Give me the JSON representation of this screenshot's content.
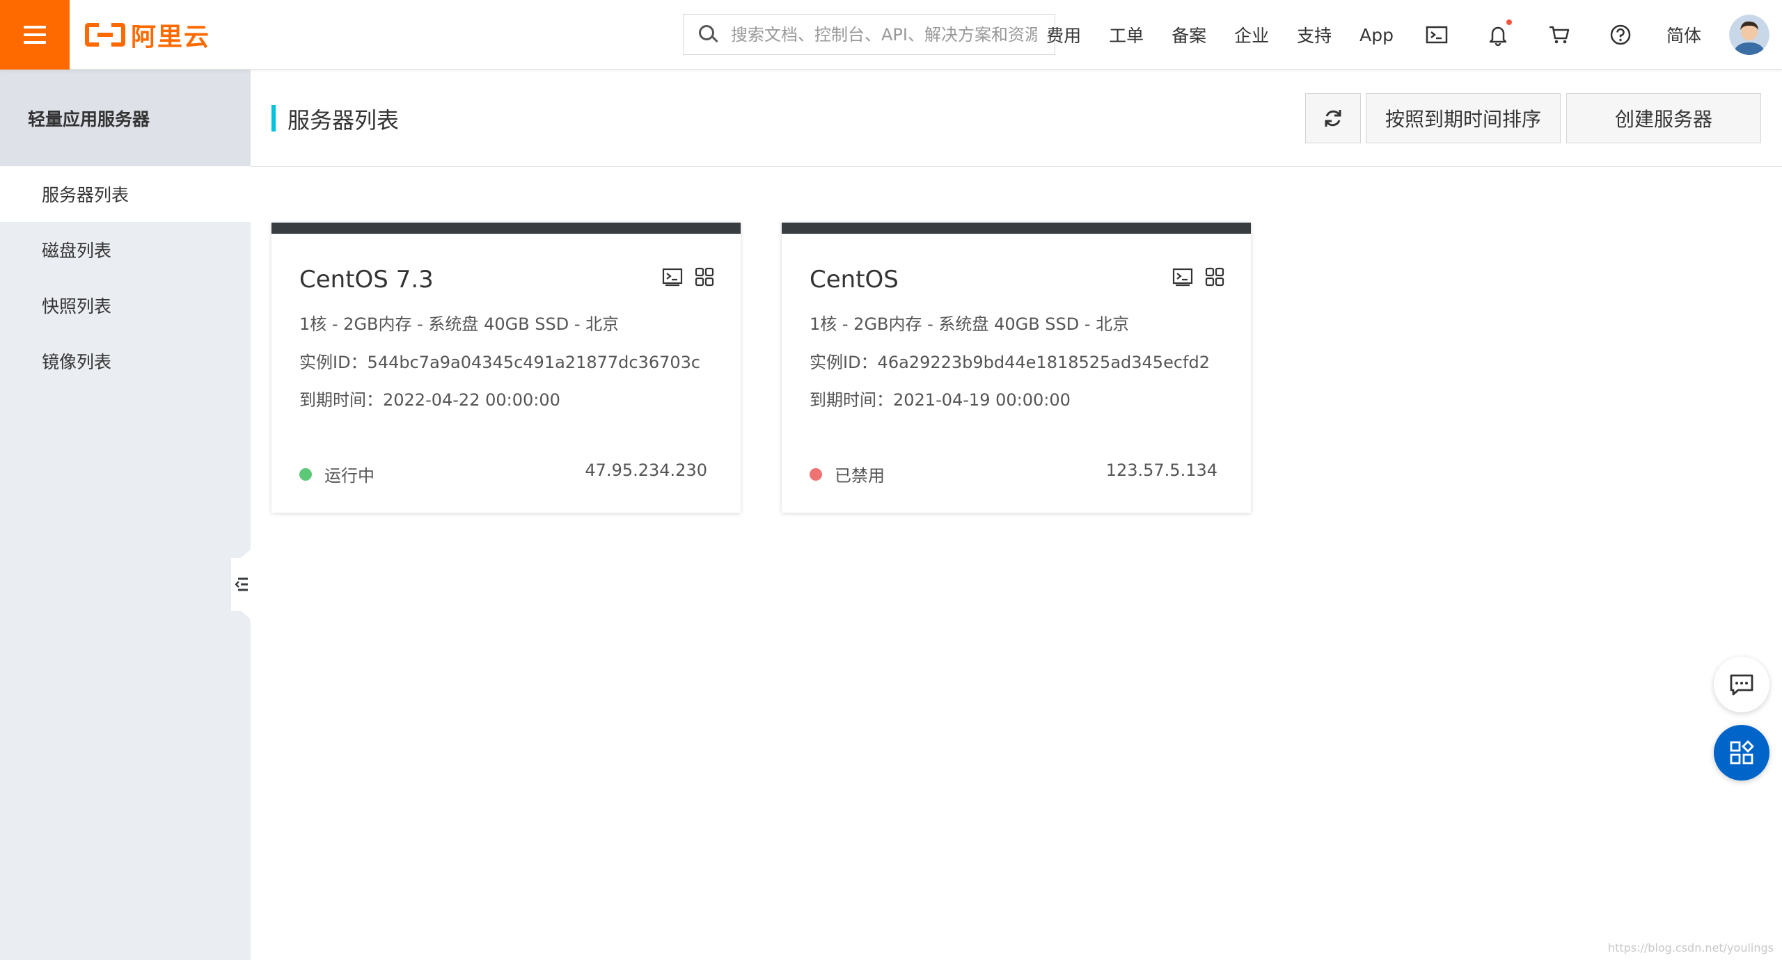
{
  "brand": {
    "name": "阿里云",
    "color": "#ff6a00"
  },
  "search": {
    "placeholder": "搜索文档、控制台、API、解决方案和资源"
  },
  "nav": {
    "items": [
      "费用",
      "工单",
      "备案",
      "企业",
      "支持",
      "App"
    ],
    "icons": [
      "terminal-icon",
      "bell-icon",
      "cart-icon",
      "help-icon"
    ],
    "language": "简体"
  },
  "sidebar": {
    "title": "轻量应用服务器",
    "items": [
      {
        "label": "服务器列表",
        "active": true
      },
      {
        "label": "磁盘列表",
        "active": false
      },
      {
        "label": "快照列表",
        "active": false
      },
      {
        "label": "镜像列表",
        "active": false
      }
    ]
  },
  "main": {
    "title": "服务器列表",
    "sort_label": "按照到期时间排序",
    "create_label": "创建服务器"
  },
  "servers": [
    {
      "name": "CentOS 7.3",
      "spec": "1核 - 2GB内存 - 系统盘 40GB SSD - 北京",
      "instance_id": "实例ID：544bc7a9a04345c491a21877dc36703c",
      "expire": "到期时间：2022-04-22 00:00:00",
      "status": "运行中",
      "status_color": "#5cc878",
      "ip": "47.95.234.230"
    },
    {
      "name": "CentOS",
      "spec": "1核 - 2GB内存 - 系统盘 40GB SSD - 北京",
      "instance_id": "实例ID：46a29223b9bd44e1818525ad345ecfd2",
      "expire": "到期时间：2021-04-19 00:00:00",
      "status": "已禁用",
      "status_color": "#f07373",
      "ip": "123.57.5.134"
    }
  ],
  "colors": {
    "accent": "#00c1de",
    "card_header": "#373d41",
    "primary_float": "#0064c8"
  },
  "watermark": "https://blog.csdn.net/youlings"
}
